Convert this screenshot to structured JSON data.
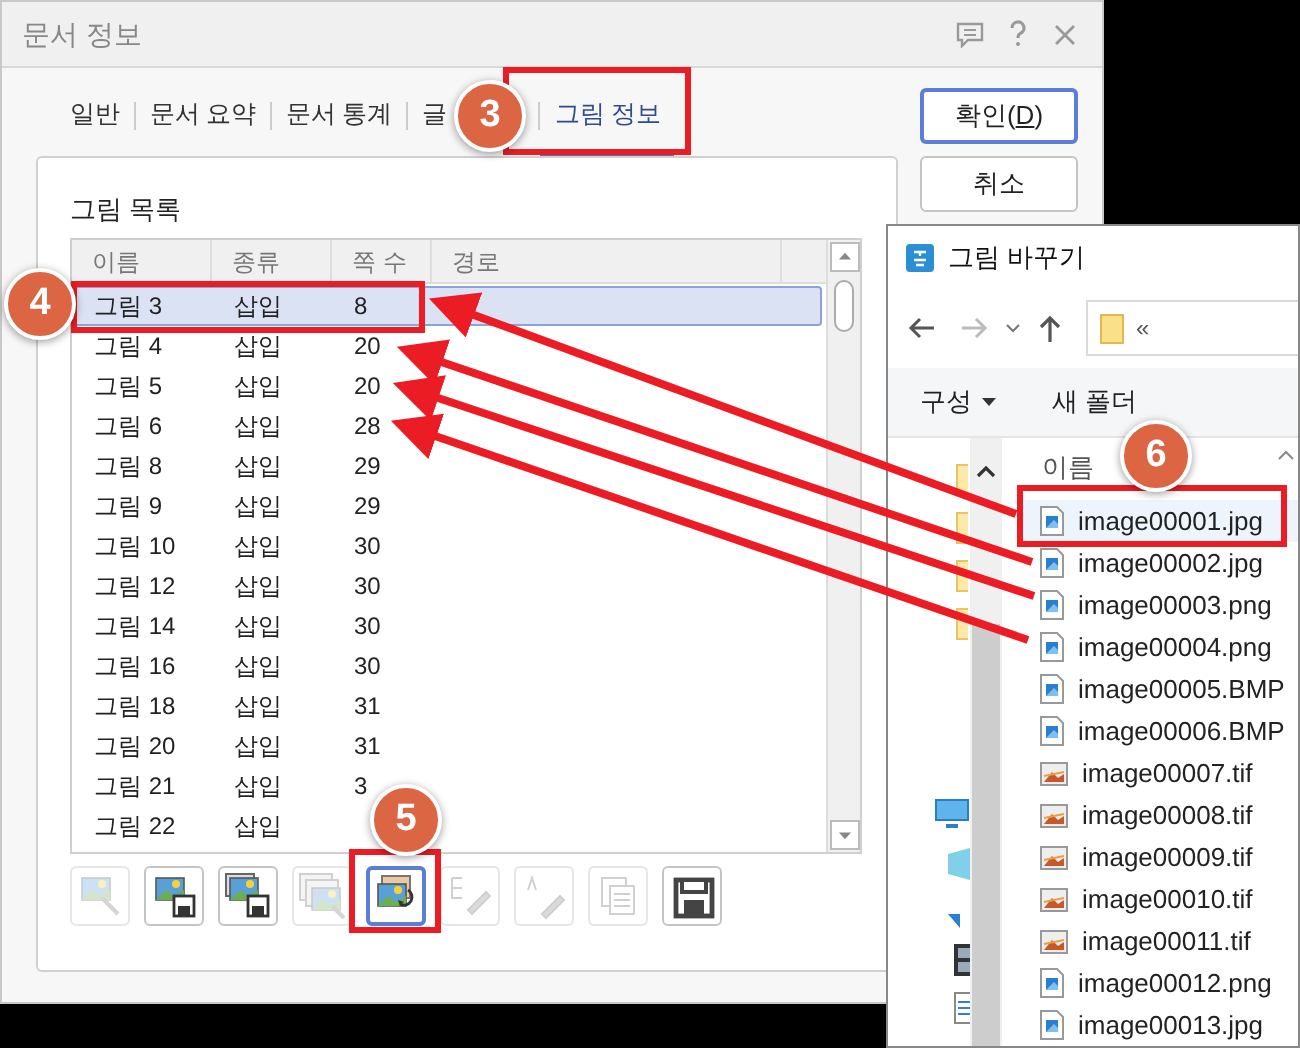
{
  "window": {
    "title": "문서 정보"
  },
  "tabs": [
    {
      "label": "일반",
      "selected": false
    },
    {
      "label": "문서 요약",
      "selected": false
    },
    {
      "label": "문서 통계",
      "selected": false
    },
    {
      "label": "글",
      "selected": false
    },
    {
      "label": "그림 정보",
      "selected": true
    }
  ],
  "buttons": [
    {
      "label": "확인(D)",
      "mnemonic_underlined": true,
      "focused": true
    },
    {
      "label": "취소",
      "focused": false
    }
  ],
  "picture_list": {
    "title": "그림 목록",
    "columns": [
      "이름",
      "종류",
      "쪽 수",
      "경로"
    ],
    "rows": [
      {
        "name": "그림 3",
        "type": "삽입",
        "page": "8",
        "selected": true
      },
      {
        "name": "그림 4",
        "type": "삽입",
        "page": "20",
        "selected": false
      },
      {
        "name": "그림 5",
        "type": "삽입",
        "page": "20",
        "selected": false
      },
      {
        "name": "그림 6",
        "type": "삽입",
        "page": "28",
        "selected": false
      },
      {
        "name": "그림 8",
        "type": "삽입",
        "page": "29",
        "selected": false
      },
      {
        "name": "그림 9",
        "type": "삽입",
        "page": "29",
        "selected": false
      },
      {
        "name": "그림 10",
        "type": "삽입",
        "page": "30",
        "selected": false
      },
      {
        "name": "그림 12",
        "type": "삽입",
        "page": "30",
        "selected": false
      },
      {
        "name": "그림 14",
        "type": "삽입",
        "page": "30",
        "selected": false
      },
      {
        "name": "그림 16",
        "type": "삽입",
        "page": "30",
        "selected": false
      },
      {
        "name": "그림 18",
        "type": "삽입",
        "page": "31",
        "selected": false
      },
      {
        "name": "그림 20",
        "type": "삽입",
        "page": "31",
        "selected": false
      },
      {
        "name": "그림 21",
        "type": "삽입",
        "page": "3",
        "selected": false
      },
      {
        "name": "그림 22",
        "type": "삽입",
        "selected": false
      }
    ]
  },
  "toolbar": [
    {
      "kind": "view",
      "disabled": true,
      "focused": false
    },
    {
      "kind": "save-one",
      "disabled": false,
      "focused": false
    },
    {
      "kind": "save-all",
      "disabled": false,
      "focused": false
    },
    {
      "kind": "view-all",
      "disabled": true,
      "focused": false
    },
    {
      "kind": "replace",
      "disabled": false,
      "focused": true
    },
    {
      "kind": "tree-edit",
      "disabled": true,
      "focused": false
    },
    {
      "kind": "text-edit",
      "disabled": true,
      "focused": false
    },
    {
      "kind": "copy",
      "disabled": true,
      "focused": false
    },
    {
      "kind": "save",
      "disabled": false,
      "focused": false
    }
  ],
  "replace_dialog": {
    "title": "그림 바꾸기",
    "address": "«",
    "organize": "구성",
    "new_folder": "새 폴더",
    "column": "이름",
    "files": [
      {
        "name": "image00001.jpg",
        "kind": "image",
        "highlighted": true
      },
      {
        "name": "image00002.jpg",
        "kind": "image",
        "highlighted": false
      },
      {
        "name": "image00003.png",
        "kind": "image",
        "highlighted": false
      },
      {
        "name": "image00004.png",
        "kind": "image",
        "highlighted": false
      },
      {
        "name": "image00005.BMP",
        "kind": "image",
        "highlighted": false
      },
      {
        "name": "image00006.BMP",
        "kind": "image",
        "highlighted": false
      },
      {
        "name": "image00007.tif",
        "kind": "tif",
        "highlighted": false
      },
      {
        "name": "image00008.tif",
        "kind": "tif",
        "highlighted": false
      },
      {
        "name": "image00009.tif",
        "kind": "tif",
        "highlighted": false
      },
      {
        "name": "image00010.tif",
        "kind": "tif",
        "highlighted": false
      },
      {
        "name": "image00011.tif",
        "kind": "tif",
        "highlighted": false
      },
      {
        "name": "image00012.png",
        "kind": "image",
        "highlighted": false
      },
      {
        "name": "image00013.jpg",
        "kind": "image",
        "highlighted": false
      }
    ]
  },
  "annotations": [
    {
      "label": "3"
    },
    {
      "label": "4"
    },
    {
      "label": "5"
    },
    {
      "label": "6"
    }
  ]
}
